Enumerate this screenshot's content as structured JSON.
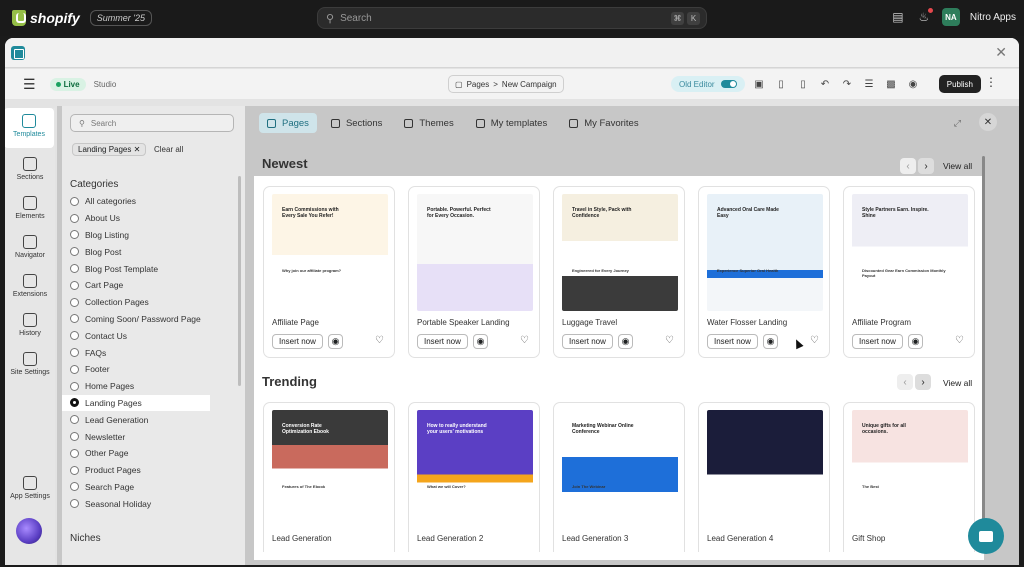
{
  "topbar": {
    "brand": "shopify",
    "season": "Summer '25",
    "search_placeholder": "Search",
    "kbd": [
      "⌘",
      "K"
    ],
    "store_initials": "NA",
    "store_name": "Nitro Apps"
  },
  "editor": {
    "live": "Live",
    "studio": "Studio",
    "crumb_root": "Pages",
    "crumb_sep": ">",
    "crumb_page": "New Campaign",
    "old_editor": "Old Editor",
    "publish": "Publish"
  },
  "rail": [
    {
      "label": "Templates",
      "icon": "templates-icon"
    },
    {
      "label": "Sections",
      "icon": "sections-icon"
    },
    {
      "label": "Elements",
      "icon": "elements-icon"
    },
    {
      "label": "Navigator",
      "icon": "navigator-icon"
    },
    {
      "label": "Extensions",
      "icon": "extensions-icon"
    },
    {
      "label": "History",
      "icon": "history-icon"
    },
    {
      "label": "Site Settings",
      "icon": "site-settings-icon"
    },
    {
      "label": "App Settings",
      "icon": "app-settings-icon"
    }
  ],
  "filters": {
    "search_placeholder": "Search",
    "chip": "Landing Pages",
    "clear_all": "Clear all",
    "categories_title": "Categories",
    "niches_title": "Niches",
    "categories": [
      "All categories",
      "About Us",
      "Blog Listing",
      "Blog Post",
      "Blog Post Template",
      "Cart Page",
      "Collection Pages",
      "Coming Soon/ Password Page",
      "Contact Us",
      "FAQs",
      "Footer",
      "Home Pages",
      "Landing Pages",
      "Lead Generation",
      "Newsletter",
      "Other Page",
      "Product Pages",
      "Search Page",
      "Seasonal Holiday"
    ],
    "selected": "Landing Pages"
  },
  "tabs": [
    "Pages",
    "Sections",
    "Themes",
    "My templates",
    "My Favorites"
  ],
  "newest": {
    "title": "Newest",
    "view_all": "View all",
    "cards": [
      {
        "name": "Affiliate Page",
        "headline": "Earn Commissions with Every Sale You Refer!",
        "sub": "Why join our affiliate program?"
      },
      {
        "name": "Portable Speaker Landing",
        "headline": "Portable. Powerful. Perfect for Every Occasion.",
        "sub": ""
      },
      {
        "name": "Luggage Travel",
        "headline": "Travel in Style, Pack with Confidence",
        "sub": "Engineered for Every Journey"
      },
      {
        "name": "Water Flosser Landing",
        "headline": "Advanced Oral Care Made Easy",
        "sub": "Experience Superior Oral Health"
      },
      {
        "name": "Affiliate Program",
        "headline": "Style Partners Earn. Inspire. Shine",
        "sub": "Discounted Gear   Earn Commission   Monthly Payout"
      }
    ]
  },
  "trending": {
    "title": "Trending",
    "view_all": "View all",
    "cards": [
      {
        "name": "Lead Generation",
        "headline": "Conversion Rate Optimization Ebook",
        "sub": "Features of The Ebook"
      },
      {
        "name": "Lead Generation 2",
        "headline": "How to really understand your users' motivations",
        "sub": "What we will Cover?"
      },
      {
        "name": "Lead Generation 3",
        "headline": "Marketing Webinar Online Conference",
        "sub": "Join The Webinar"
      },
      {
        "name": "Lead Generation 4",
        "headline": "",
        "sub": ""
      },
      {
        "name": "Gift Shop",
        "headline": "Unique gifts for all occasions.",
        "sub": "The Best"
      }
    ]
  },
  "buttons": {
    "insert": "Insert now"
  }
}
